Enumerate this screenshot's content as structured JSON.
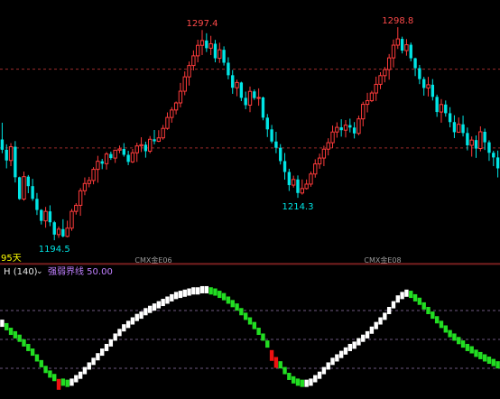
{
  "colors": {
    "background": "#000000",
    "up_candle": "#ff3b3b",
    "down_candle": "#00e5e5",
    "ref_line_price": "#9a2b2b",
    "ref_line_ind": "#8a6fa0",
    "divider": "#a02a2a",
    "contract_label": "#9a9a9a",
    "bar_green": "#22dd22",
    "bar_white": "#ffffff",
    "bar_red": "#ee1111",
    "high_label": "#ff4a4a",
    "low_label": "#00e5e5",
    "period_label": "#ffff00",
    "ind_name": "#e8e8e8",
    "ind_params": "#c080ff"
  },
  "price_panel": {
    "period_label": "95天",
    "high_labels": [
      "1297.4",
      "1298.8"
    ],
    "low_labels": [
      "1194.5",
      "1214.3"
    ],
    "contract_labels": [
      "CMX金E06",
      "CMX金E08"
    ],
    "ref_levels": [
      1239,
      1278
    ]
  },
  "indicator_panel": {
    "name": "H (140)",
    "dropdown_icon": "chevron-down-icon",
    "params_text": "强弱界线 50.00",
    "threshold": 50
  },
  "chart_data": {
    "type": "candlestick+histogram",
    "price_range": [
      1188,
      1306
    ],
    "extreme_points": [
      {
        "label": "1194.5",
        "kind": "low"
      },
      {
        "label": "1297.4",
        "kind": "high"
      },
      {
        "label": "1214.3",
        "kind": "low"
      },
      {
        "label": "1298.8",
        "kind": "high"
      }
    ],
    "indicator_range": [
      0,
      100
    ],
    "candles": [
      [
        1243.2,
        1251.5,
        1236.4,
        1238.1
      ],
      [
        1238.1,
        1240.8,
        1228.9,
        1232.8
      ],
      [
        1232.8,
        1241.4,
        1230.0,
        1239.6
      ],
      [
        1239.6,
        1242.4,
        1221.9,
        1224.5
      ],
      [
        1224.5,
        1224.8,
        1213.3,
        1213.7
      ],
      [
        1213.7,
        1227.3,
        1212.9,
        1224.8
      ],
      [
        1224.8,
        1225.6,
        1216.6,
        1220.1
      ],
      [
        1220.1,
        1223.7,
        1212.8,
        1213.8
      ],
      [
        1213.8,
        1216.7,
        1205.8,
        1208.3
      ],
      [
        1208.3,
        1208.7,
        1201.1,
        1202.9
      ],
      [
        1202.9,
        1209.8,
        1199.5,
        1207.6
      ],
      [
        1207.6,
        1210.6,
        1200.3,
        1202.2
      ],
      [
        1202.2,
        1202.9,
        1193.3,
        1196.1
      ],
      [
        1196.1,
        1200.1,
        1194.5,
        1198.8
      ],
      [
        1198.8,
        1203.7,
        1194.7,
        1195.2
      ],
      [
        1195.2,
        1203.0,
        1194.7,
        1199.3
      ],
      [
        1199.3,
        1208.8,
        1198.0,
        1207.6
      ],
      [
        1207.6,
        1211.7,
        1206.0,
        1210.6
      ],
      [
        1210.6,
        1219.1,
        1205.4,
        1217.8
      ],
      [
        1217.8,
        1224.4,
        1215.6,
        1221.4
      ],
      [
        1221.4,
        1224.7,
        1219.5,
        1222.9
      ],
      [
        1222.9,
        1229.5,
        1221.0,
        1228.4
      ],
      [
        1228.4,
        1235.1,
        1221.8,
        1232.4
      ],
      [
        1232.4,
        1233.6,
        1228.5,
        1231.2
      ],
      [
        1231.2,
        1237.0,
        1228.3,
        1236.0
      ],
      [
        1236.0,
        1237.2,
        1233.1,
        1234.0
      ],
      [
        1234.0,
        1238.1,
        1231.6,
        1237.9
      ],
      [
        1237.9,
        1240.2,
        1236.4,
        1238.5
      ],
      [
        1238.5,
        1241.4,
        1234.7,
        1235.6
      ],
      [
        1235.6,
        1237.6,
        1230.5,
        1232.1
      ],
      [
        1232.1,
        1238.5,
        1231.5,
        1236.6
      ],
      [
        1236.6,
        1241.6,
        1232.1,
        1240.0
      ],
      [
        1240.0,
        1244.3,
        1237.0,
        1240.6
      ],
      [
        1240.6,
        1242.1,
        1234.2,
        1237.4
      ],
      [
        1237.4,
        1244.9,
        1236.4,
        1243.3
      ],
      [
        1243.3,
        1247.9,
        1240.8,
        1242.3
      ],
      [
        1242.3,
        1247.8,
        1241.9,
        1244.0
      ],
      [
        1244.0,
        1250.4,
        1243.1,
        1248.7
      ],
      [
        1248.7,
        1256.6,
        1248.0,
        1254.1
      ],
      [
        1254.1,
        1259.2,
        1251.5,
        1257.8
      ],
      [
        1257.8,
        1262.0,
        1255.6,
        1261.3
      ],
      [
        1261.3,
        1271.2,
        1259.1,
        1267.1
      ],
      [
        1267.1,
        1276.9,
        1265.1,
        1274.2
      ],
      [
        1274.2,
        1281.8,
        1269.9,
        1279.8
      ],
      [
        1279.8,
        1287.3,
        1277.4,
        1284.6
      ],
      [
        1284.6,
        1292.6,
        1281.4,
        1289.8
      ],
      [
        1289.8,
        1297.4,
        1285.0,
        1292.2
      ],
      [
        1292.2,
        1295.8,
        1286.5,
        1288.4
      ],
      [
        1288.4,
        1294.5,
        1285.0,
        1290.6
      ],
      [
        1290.6,
        1292.5,
        1281.4,
        1283.4
      ],
      [
        1283.4,
        1291.1,
        1281.1,
        1287.6
      ],
      [
        1287.6,
        1289.3,
        1279.8,
        1281.2
      ],
      [
        1281.2,
        1283.9,
        1273.0,
        1275.0
      ],
      [
        1275.0,
        1277.6,
        1265.8,
        1268.8
      ],
      [
        1268.8,
        1272.8,
        1264.6,
        1271.4
      ],
      [
        1271.4,
        1271.8,
        1262.2,
        1263.8
      ],
      [
        1263.8,
        1266.9,
        1258.2,
        1260.2
      ],
      [
        1260.2,
        1269.4,
        1256.7,
        1267.0
      ],
      [
        1267.0,
        1268.0,
        1262.8,
        1263.7
      ],
      [
        1263.7,
        1268.5,
        1259.9,
        1264.0
      ],
      [
        1264.0,
        1264.4,
        1252.7,
        1254.0
      ],
      [
        1254.0,
        1255.8,
        1244.4,
        1248.2
      ],
      [
        1248.2,
        1250.4,
        1241.3,
        1242.2
      ],
      [
        1242.2,
        1247.0,
        1236.4,
        1239.1
      ],
      [
        1239.1,
        1240.9,
        1230.8,
        1232.5
      ],
      [
        1232.5,
        1236.5,
        1223.3,
        1227.1
      ],
      [
        1227.1,
        1228.7,
        1217.7,
        1220.6
      ],
      [
        1220.6,
        1225.3,
        1219.4,
        1223.4
      ],
      [
        1223.4,
        1225.4,
        1214.3,
        1216.7
      ],
      [
        1216.7,
        1223.4,
        1215.9,
        1218.9
      ],
      [
        1218.9,
        1223.4,
        1218.4,
        1221.1
      ],
      [
        1221.1,
        1227.3,
        1219.8,
        1226.1
      ],
      [
        1226.1,
        1233.4,
        1224.3,
        1231.1
      ],
      [
        1231.1,
        1236.2,
        1228.7,
        1234.0
      ],
      [
        1234.0,
        1240.1,
        1230.0,
        1238.4
      ],
      [
        1238.4,
        1243.8,
        1235.3,
        1241.6
      ],
      [
        1241.6,
        1250.1,
        1239.0,
        1246.9
      ],
      [
        1246.9,
        1251.7,
        1244.1,
        1249.2
      ],
      [
        1249.2,
        1253.2,
        1244.6,
        1247.8
      ],
      [
        1247.8,
        1252.8,
        1244.2,
        1250.3
      ],
      [
        1250.3,
        1253.5,
        1246.7,
        1249.1
      ],
      [
        1249.1,
        1251.8,
        1243.7,
        1246.2
      ],
      [
        1246.2,
        1255.0,
        1245.3,
        1253.4
      ],
      [
        1253.4,
        1261.9,
        1249.7,
        1260.6
      ],
      [
        1260.6,
        1266.3,
        1256.6,
        1262.4
      ],
      [
        1262.4,
        1267.3,
        1261.7,
        1266.2
      ],
      [
        1266.2,
        1274.3,
        1262.3,
        1270.5
      ],
      [
        1270.5,
        1276.5,
        1268.1,
        1274.8
      ],
      [
        1274.8,
        1279.1,
        1271.5,
        1277.8
      ],
      [
        1277.8,
        1285.5,
        1272.8,
        1283.6
      ],
      [
        1283.6,
        1292.7,
        1278.9,
        1289.9
      ],
      [
        1289.9,
        1298.8,
        1288.0,
        1293.0
      ],
      [
        1293.0,
        1294.1,
        1285.8,
        1287.2
      ],
      [
        1287.2,
        1292.9,
        1284.7,
        1290.1
      ],
      [
        1290.1,
        1291.2,
        1281.9,
        1283.4
      ],
      [
        1283.4,
        1283.7,
        1274.6,
        1278.5
      ],
      [
        1278.5,
        1280.1,
        1270.6,
        1273.1
      ],
      [
        1273.1,
        1274.2,
        1264.9,
        1268.7
      ],
      [
        1268.7,
        1274.2,
        1264.5,
        1270.3
      ],
      [
        1270.3,
        1273.1,
        1262.5,
        1264.3
      ],
      [
        1264.3,
        1265.4,
        1254.4,
        1256.8
      ],
      [
        1256.8,
        1263.2,
        1251.5,
        1260.5
      ],
      [
        1260.5,
        1262.5,
        1254.5,
        1256.2
      ],
      [
        1256.2,
        1259.2,
        1249.2,
        1251.8
      ],
      [
        1251.8,
        1255.2,
        1243.9,
        1246.8
      ],
      [
        1246.8,
        1254.1,
        1246.5,
        1250.7
      ],
      [
        1250.7,
        1255.0,
        1244.7,
        1246.4
      ],
      [
        1246.4,
        1249.1,
        1237.8,
        1240.3
      ],
      [
        1240.3,
        1244.7,
        1234.7,
        1242.9
      ],
      [
        1242.9,
        1245.2,
        1234.1,
        1238.7
      ],
      [
        1238.7,
        1249.7,
        1237.3,
        1247.0
      ],
      [
        1247.0,
        1248.6,
        1238.0,
        1241.8
      ],
      [
        1241.8,
        1242.8,
        1232.6,
        1236.6
      ],
      [
        1236.6,
        1237.6,
        1230.0,
        1234.3
      ],
      [
        1234.3,
        1237.7,
        1224.4,
        1228.9
      ]
    ],
    "indicator_values": [
      64,
      61,
      57,
      54,
      51,
      47,
      43,
      39,
      34,
      29,
      24,
      20,
      17,
      15,
      13,
      12,
      13,
      16,
      19,
      23,
      27,
      31,
      35,
      39,
      43,
      47,
      52,
      56,
      60,
      63,
      66,
      69,
      71,
      74,
      76,
      78,
      80,
      82,
      84,
      86,
      88,
      89,
      90,
      91,
      92,
      92,
      93,
      93,
      92,
      91,
      89,
      87,
      84,
      81,
      78,
      74,
      70,
      66,
      62,
      57,
      52,
      46,
      40,
      34,
      28,
      23,
      18,
      15,
      13,
      12,
      12,
      13,
      16,
      19,
      23,
      27,
      31,
      34,
      37,
      40,
      43,
      45,
      48,
      51,
      54,
      58,
      62,
      66,
      70,
      75,
      80,
      85,
      88,
      90,
      89,
      86,
      83,
      79,
      75,
      71,
      67,
      63,
      59,
      55,
      52,
      49,
      46,
      43,
      41,
      38,
      36,
      34,
      32,
      30,
      28
    ],
    "indicator_red_bars": [
      13,
      62,
      63
    ]
  }
}
